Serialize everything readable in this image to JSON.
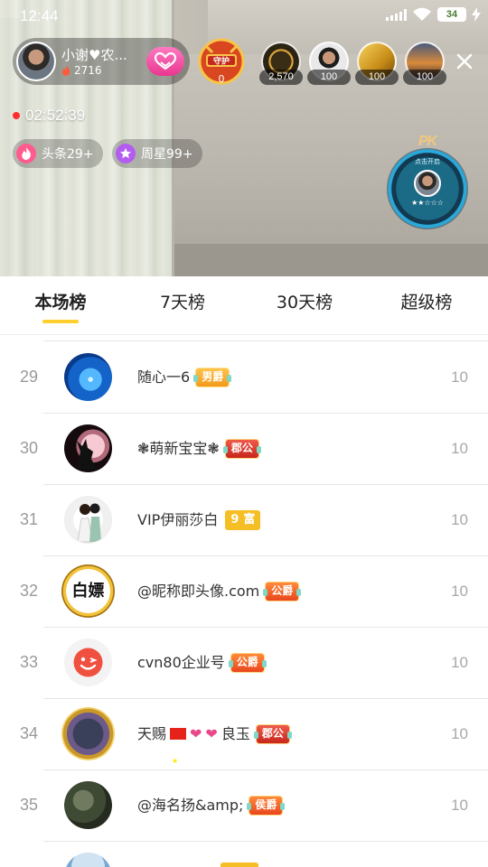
{
  "status_bar": {
    "time": "12:44",
    "battery": "34"
  },
  "anchor": {
    "name": "小谢♥农...",
    "fans": "2716"
  },
  "guard": {
    "label": "守护",
    "count": "0"
  },
  "viewers": [
    {
      "count": "2,570"
    },
    {
      "count": "100"
    },
    {
      "count": "100"
    },
    {
      "count": "100"
    }
  ],
  "live_timer": "02:52:39",
  "rank_chips": [
    {
      "label": "头条29+"
    },
    {
      "label": "周星99+"
    }
  ],
  "pk_widget": {
    "title": "PK",
    "subtitle": "点击开启",
    "stars": "★★☆☆☆"
  },
  "tabs": [
    {
      "label": "本场榜"
    },
    {
      "label": "7天榜"
    },
    {
      "label": "30天榜"
    },
    {
      "label": "超级榜"
    }
  ],
  "rows": [
    {
      "rank": "29",
      "name": "随心一6",
      "badge": "男爵",
      "score": "10"
    },
    {
      "rank": "30",
      "name": "❃萌新宝宝❃",
      "badge": "郡公",
      "score": "10"
    },
    {
      "rank": "31",
      "name": "VIP伊丽莎白",
      "wealth_level": "9",
      "wealth_label": "富",
      "score": "10"
    },
    {
      "rank": "32",
      "name": "@昵称即头像.com",
      "badge": "公爵",
      "score": "10"
    },
    {
      "rank": "33",
      "name": "cvn80企业号",
      "badge": "公爵",
      "score": "10"
    },
    {
      "rank": "34",
      "name_start": "天赐",
      "name_end": "良玉",
      "badge": "郡公",
      "score": "10"
    },
    {
      "rank": "35",
      "name": "@海名扬&amp;",
      "badge": "侯爵",
      "score": "10"
    }
  ],
  "avatar_text": {
    "row32": "白嫖"
  }
}
